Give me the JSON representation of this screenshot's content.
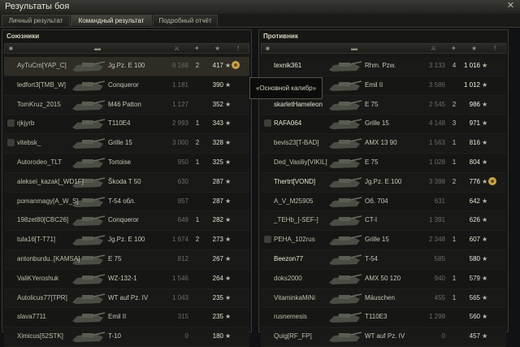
{
  "window": {
    "title": "Результаты боя",
    "close_icon": "close-icon"
  },
  "tabs": [
    {
      "label": "Личный результат",
      "active": false
    },
    {
      "label": "Командный результат",
      "active": true
    },
    {
      "label": "Подробный отчёт",
      "active": false
    }
  ],
  "allies": {
    "title": "Союзники",
    "rows": [
      {
        "name": "AyTuCm[YAP_C]",
        "tank": "Jg.Pz. E 100",
        "damage": "6 168",
        "frags": "2",
        "xp": "417",
        "self": true,
        "medal": true
      },
      {
        "name": "ledfort3[TMB_W]",
        "tank": "Conqueror",
        "damage": "1 181",
        "frags": "",
        "xp": "390"
      },
      {
        "name": "TomKruz_2015",
        "tank": "M46 Patton",
        "damage": "1 127",
        "frags": "",
        "xp": "352"
      },
      {
        "name": "rjkjyrb",
        "tank": "T110E4",
        "damage": "2 993",
        "frags": "1",
        "xp": "343",
        "clan": true
      },
      {
        "name": "vitebsk_",
        "tank": "Grille 15",
        "damage": "3 000",
        "frags": "2",
        "xp": "328",
        "clan": true
      },
      {
        "name": "Autorodeo_TLT",
        "tank": "Tortoise",
        "damage": "950",
        "frags": "1",
        "xp": "325"
      },
      {
        "name": "aleksei_kazak[_WD1F]",
        "tank": "Škoda T 50",
        "damage": "630",
        "frags": "",
        "xp": "287"
      },
      {
        "name": "pomanmagy[A_W_S]",
        "tank": "T-54 обл.",
        "damage": "957",
        "frags": "",
        "xp": "287"
      },
      {
        "name": "198zet80[CBC26]",
        "tank": "Conqueror",
        "damage": "649",
        "frags": "1",
        "xp": "282"
      },
      {
        "name": "tula16[T-T71]",
        "tank": "Jg.Pz. E 100",
        "damage": "1 674",
        "frags": "2",
        "xp": "273"
      },
      {
        "name": "antonburdu..[KAMSA]",
        "tank": "E 75",
        "damage": "812",
        "frags": "",
        "xp": "267"
      },
      {
        "name": "ValiKYeroshuk",
        "tank": "WZ-132-1",
        "damage": "1 546",
        "frags": "",
        "xp": "264"
      },
      {
        "name": "Autolicus77[TPR]",
        "tank": "WT auf Pz. IV",
        "damage": "1 043",
        "frags": "",
        "xp": "235"
      },
      {
        "name": "slava7711",
        "tank": "Emil II",
        "damage": "315",
        "frags": "",
        "xp": "235"
      },
      {
        "name": "Ximicus[52STK]",
        "tank": "T-10",
        "damage": "0",
        "frags": "",
        "xp": "180"
      }
    ]
  },
  "enemies": {
    "title": "Противник",
    "rows": [
      {
        "name": "texnik361",
        "tank": "Rhm. Pzw.",
        "damage": "3 133",
        "frags": "4",
        "xp": "1 016",
        "alive": true
      },
      {
        "name": "",
        "tank": "Emil II",
        "damage": "3 586",
        "frags": "",
        "xp": "1 012",
        "alive": true
      },
      {
        "name": "skarletHameleon",
        "tank": "E 75",
        "damage": "2 545",
        "frags": "2",
        "xp": "986",
        "alive": true
      },
      {
        "name": "RAFA064",
        "tank": "Grille 15",
        "damage": "4 148",
        "frags": "3",
        "xp": "971",
        "alive": true,
        "clan": true
      },
      {
        "name": "bevis23[T-BAD]",
        "tank": "AMX 13 90",
        "damage": "1 563",
        "frags": "1",
        "xp": "816"
      },
      {
        "name": "Ded_Vasiliy[VIKIL]",
        "tank": "E 75",
        "damage": "1 028",
        "frags": "1",
        "xp": "804"
      },
      {
        "name": "Thertrt[VOND]",
        "tank": "Jg.Pz. E 100",
        "damage": "3 398",
        "frags": "2",
        "xp": "776",
        "alive": true,
        "medal": true
      },
      {
        "name": "A_V_M25905",
        "tank": "Об. 704",
        "damage": "631",
        "frags": "",
        "xp": "642"
      },
      {
        "name": "_TEHb_[-SEF-]",
        "tank": "CT-I",
        "damage": "1 391",
        "frags": "",
        "xp": "626"
      },
      {
        "name": "PEHA_102rus",
        "tank": "Grille 15",
        "damage": "2 348",
        "frags": "1",
        "xp": "607",
        "clan": true
      },
      {
        "name": "Beezon77",
        "tank": "T-54",
        "damage": "585",
        "frags": "",
        "xp": "580",
        "alive": true
      },
      {
        "name": "doks2000",
        "tank": "AMX 50 120",
        "damage": "940",
        "frags": "1",
        "xp": "579"
      },
      {
        "name": "VitaminkaMiNi",
        "tank": "Mäuschen",
        "damage": "455",
        "frags": "1",
        "xp": "565"
      },
      {
        "name": "rusnemesis",
        "tank": "T110E3",
        "damage": "1 299",
        "frags": "",
        "xp": "560"
      },
      {
        "name": "Quig[RF_FP]",
        "tank": "WT auf Pz. IV",
        "damage": "0",
        "frags": "",
        "xp": "457"
      }
    ]
  },
  "tooltip": {
    "text": "«Основной калибр»"
  },
  "colors": {
    "background": "#111213",
    "self_row": "#2e2c25",
    "text": "#c8c4b8",
    "medal": "#c9a34a"
  }
}
